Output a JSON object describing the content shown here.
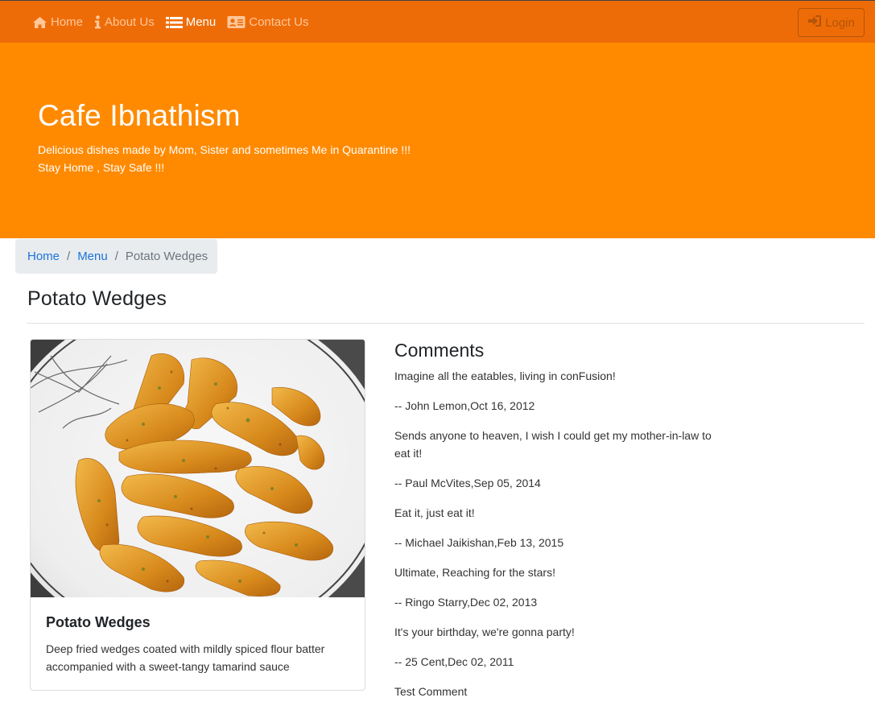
{
  "navbar": {
    "items": [
      {
        "label": "Home",
        "icon": "home-icon"
      },
      {
        "label": "About Us",
        "icon": "info-icon"
      },
      {
        "label": "Menu",
        "icon": "list-icon"
      },
      {
        "label": "Contact Us",
        "icon": "address-card-icon"
      }
    ],
    "active_index": 2,
    "login_label": "Login",
    "colors": {
      "background": "#ee6c07",
      "inactive_text": "#ffc79a",
      "active_text": "#ffffff"
    }
  },
  "jumbotron": {
    "title": "Cafe Ibnathism",
    "line1": "Delicious dishes made by Mom, Sister and sometimes Me in Quarantine !!!",
    "line2": "Stay Home , Stay Safe !!!",
    "background": "#ff8a00"
  },
  "breadcrumb": {
    "items": [
      "Home",
      "Menu"
    ],
    "current": "Potato Wedges"
  },
  "page": {
    "title": "Potato Wedges"
  },
  "dish": {
    "name": "Potato Wedges",
    "description": "Deep fried wedges coated with mildly spiced flour batter accompanied with a sweet-tangy tamarind sauce"
  },
  "comments": {
    "heading": "Comments",
    "items": [
      {
        "text": "Imagine all the eatables, living in conFusion!",
        "author": "-- John Lemon,Oct 16, 2012"
      },
      {
        "text": "Sends anyone to heaven, I wish I could get my mother-in-law to eat it!",
        "author": "-- Paul McVites,Sep 05, 2014"
      },
      {
        "text": "Eat it, just eat it!",
        "author": "-- Michael Jaikishan,Feb 13, 2015"
      },
      {
        "text": "Ultimate, Reaching for the stars!",
        "author": "-- Ringo Starry,Dec 02, 2013"
      },
      {
        "text": "It's your birthday, we're gonna party!",
        "author": "-- 25 Cent,Dec 02, 2011"
      },
      {
        "text": "Test Comment",
        "author": ""
      }
    ]
  }
}
